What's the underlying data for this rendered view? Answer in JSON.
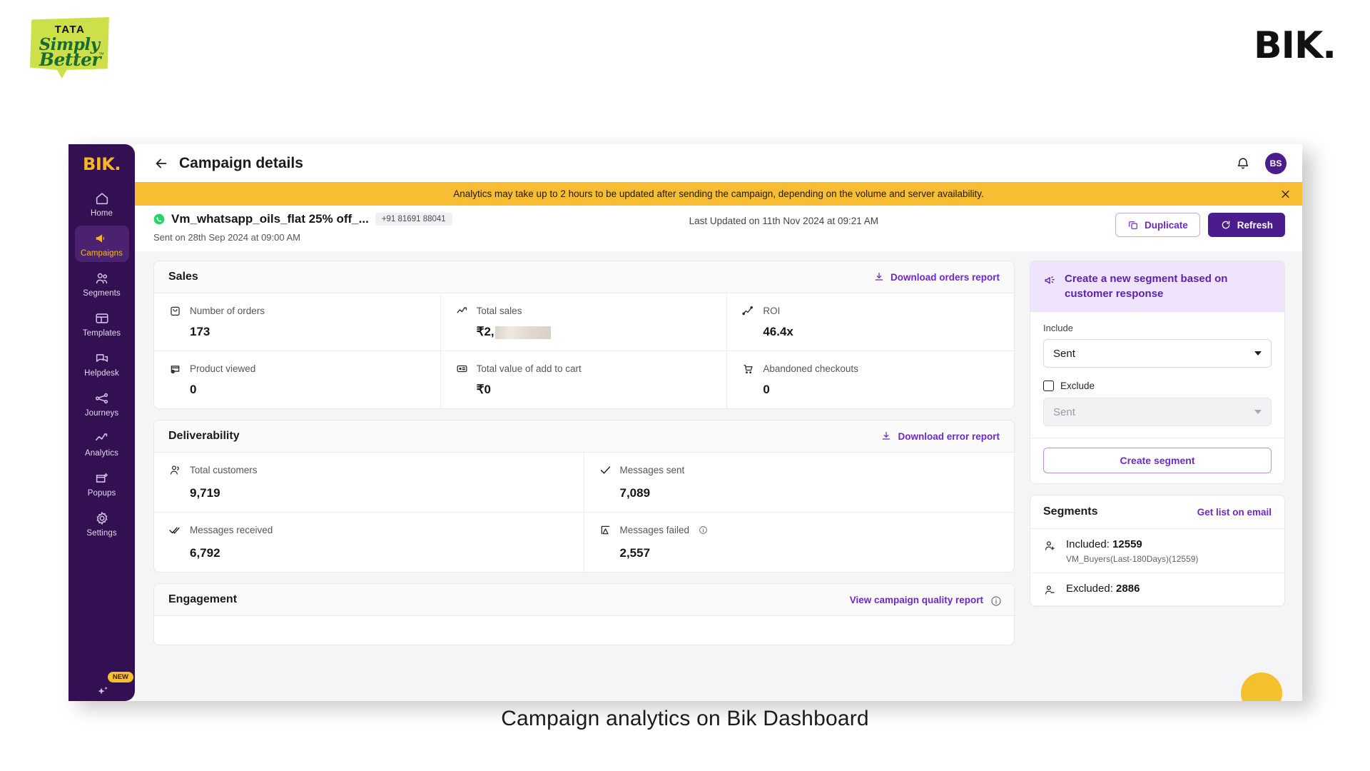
{
  "brand": {
    "tata_tata": "TATA",
    "tata_simply": "Simply",
    "tata_better": "Better",
    "tata_tm": "™",
    "bik_wordmark": "BIK.",
    "sidebar_logo": "BIK.",
    "accent_purple": "#6d29c9",
    "sidebar_purple": "#331052",
    "brand_yellow": "#f5b824",
    "banner_yellow": "#f8bd32"
  },
  "caption": "Campaign analytics on Bik Dashboard",
  "sidebar": {
    "items": [
      {
        "label": "Home",
        "icon": "home-icon",
        "active": false
      },
      {
        "label": "Campaigns",
        "icon": "megaphone-icon",
        "active": true
      },
      {
        "label": "Segments",
        "icon": "users-icon",
        "active": false
      },
      {
        "label": "Templates",
        "icon": "layout-icon",
        "active": false
      },
      {
        "label": "Helpdesk",
        "icon": "chat-icon",
        "active": false
      },
      {
        "label": "Journeys",
        "icon": "nodes-icon",
        "active": false
      },
      {
        "label": "Analytics",
        "icon": "chart-line-icon",
        "active": false
      },
      {
        "label": "Popups",
        "icon": "popup-icon",
        "active": false
      },
      {
        "label": "Settings",
        "icon": "gear-icon",
        "active": false
      }
    ],
    "new_badge": "NEW"
  },
  "topbar": {
    "title": "Campaign details",
    "back_icon": "arrow-left-icon",
    "bell_icon": "bell-icon",
    "avatar_initials": "BS"
  },
  "banner": {
    "text": "Analytics may take up to 2 hours to be updated after sending the campaign, depending on the volume and server availability.",
    "close_icon": "close-icon"
  },
  "campaign": {
    "channel_icon": "whatsapp-icon",
    "name": "Vm_whatsapp_oils_flat 25% off_...",
    "phone": "+91 81691 88041",
    "sent_on": "Sent on 28th Sep 2024 at 09:00 AM",
    "last_updated": "Last Updated on 11th Nov 2024 at 09:21 AM",
    "duplicate_label": "Duplicate",
    "refresh_label": "Refresh"
  },
  "sales": {
    "title": "Sales",
    "download_label": "Download orders report",
    "metrics": [
      {
        "label": "Number of orders",
        "value": "173",
        "icon": "bag-icon",
        "redacted": false
      },
      {
        "label": "Total sales",
        "value": "₹2,",
        "icon": "chart-line-icon",
        "redacted": true
      },
      {
        "label": "ROI",
        "value": "46.4x",
        "icon": "trend-up-icon",
        "redacted": false
      },
      {
        "label": "Product viewed",
        "value": "0",
        "icon": "product-view-icon",
        "redacted": false
      },
      {
        "label": "Total value of add to cart",
        "value": "₹0",
        "icon": "cart-card-icon",
        "redacted": false
      },
      {
        "label": "Abandoned checkouts",
        "value": "0",
        "icon": "cart-icon",
        "redacted": false
      }
    ]
  },
  "deliverability": {
    "title": "Deliverability",
    "download_label": "Download error report",
    "metrics": [
      {
        "label": "Total customers",
        "value": "9,719",
        "icon": "people-icon",
        "info": false
      },
      {
        "label": "Messages sent",
        "value": "7,089",
        "icon": "check-icon",
        "info": false
      },
      {
        "label": "Messages received",
        "value": "6,792",
        "icon": "double-check-icon",
        "info": false
      },
      {
        "label": "Messages failed",
        "value": "2,557",
        "icon": "failed-icon",
        "info": true
      }
    ]
  },
  "engagement": {
    "title": "Engagement",
    "report_label": "View campaign quality report",
    "info_icon": "info-icon"
  },
  "segment_panel": {
    "banner_text": "Create a new segment based on customer response",
    "banner_icon": "segment-icon",
    "include_label": "Include",
    "include_value": "Sent",
    "exclude_label": "Exclude",
    "exclude_value": "Sent",
    "create_label": "Create segment"
  },
  "segments": {
    "title": "Segments",
    "link_label": "Get list on email",
    "items": [
      {
        "icon": "user-plus-icon",
        "label": "Included: ",
        "count": "12559",
        "sub": "VM_Buyers(Last-180Days)(12559)"
      },
      {
        "icon": "user-minus-icon",
        "label": "Excluded: ",
        "count": "2886",
        "sub": ""
      }
    ]
  }
}
